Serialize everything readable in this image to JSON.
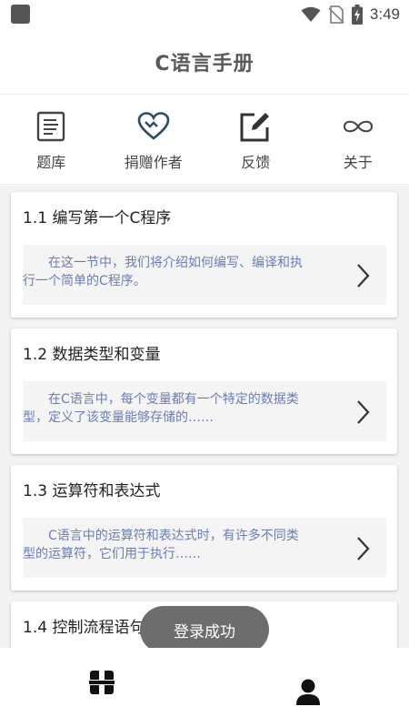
{
  "status_bar": {
    "time": "3:49"
  },
  "app": {
    "title": "C语言手册"
  },
  "nav": [
    {
      "label": "题库",
      "icon": "document-list-icon"
    },
    {
      "label": "捐赠作者",
      "icon": "heart-icon"
    },
    {
      "label": "反馈",
      "icon": "edit-icon"
    },
    {
      "label": "关于",
      "icon": "infinity-icon"
    }
  ],
  "lessons": [
    {
      "title": "1.1 编写第一个C程序",
      "description": "在这一节中，我们将介绍如何编写、编译和执行一个简单的C程序。"
    },
    {
      "title": "1.2 数据类型和变量",
      "description": "在C语言中，每个变量都有一个特定的数据类型，定义了该变量能够存储的……"
    },
    {
      "title": "1.3 运算符和表达式",
      "description": "C语言中的运算符和表达式时，有许多不同类型的运算符，它们用于执行……"
    },
    {
      "title": "1.4 控制流程语句",
      "description": ""
    }
  ],
  "toast": {
    "message": "登录成功"
  },
  "bottom_tabs": [
    {
      "name": "home",
      "icon": "grid-icon"
    },
    {
      "name": "profile",
      "icon": "user-icon"
    }
  ]
}
